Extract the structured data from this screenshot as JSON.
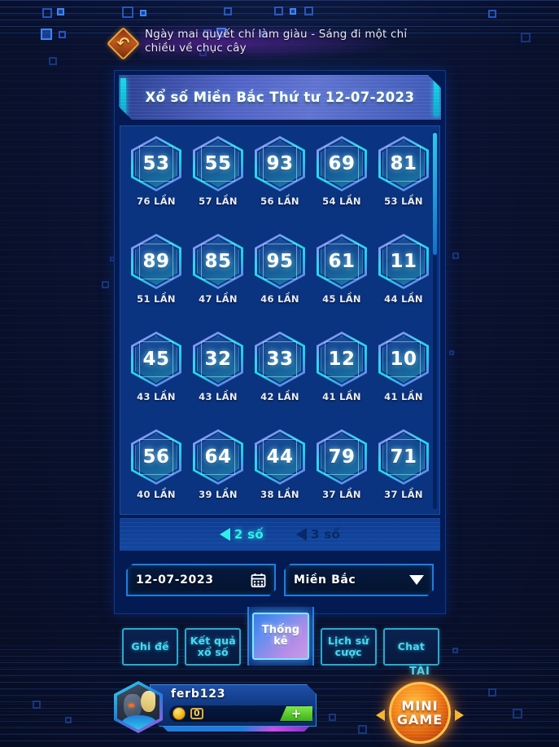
{
  "topbar": {
    "back_icon": "back-arrow-icon",
    "marquee": "Ngày mai quyết chí làm giàu - Sáng đi một chỉ chiều về chục cây"
  },
  "panel": {
    "title": "Xổ số Miền Bắc Thứ tư 12-07-2023"
  },
  "stats": {
    "rows": [
      [
        {
          "number": "53",
          "count": "76 LẦN"
        },
        {
          "number": "55",
          "count": "57 LẦN"
        },
        {
          "number": "93",
          "count": "56 LẦN"
        },
        {
          "number": "69",
          "count": "54 LẦN"
        },
        {
          "number": "81",
          "count": "53 LẦN"
        }
      ],
      [
        {
          "number": "89",
          "count": "51 LẦN"
        },
        {
          "number": "85",
          "count": "47 LẦN"
        },
        {
          "number": "95",
          "count": "46 LẦN"
        },
        {
          "number": "61",
          "count": "45 LẦN"
        },
        {
          "number": "11",
          "count": "44 LẦN"
        }
      ],
      [
        {
          "number": "45",
          "count": "43 LẦN"
        },
        {
          "number": "32",
          "count": "43 LẦN"
        },
        {
          "number": "33",
          "count": "42 LẦN"
        },
        {
          "number": "12",
          "count": "41 LẦN"
        },
        {
          "number": "10",
          "count": "41 LẦN"
        }
      ],
      [
        {
          "number": "56",
          "count": "40 LẦN"
        },
        {
          "number": "64",
          "count": "39 LẦN"
        },
        {
          "number": "44",
          "count": "38 LẦN"
        },
        {
          "number": "79",
          "count": "37 LẦN"
        },
        {
          "number": "71",
          "count": "37 LẦN"
        }
      ]
    ]
  },
  "toggles": [
    {
      "label": "2 số",
      "active": true
    },
    {
      "label": "3 số",
      "active": false
    }
  ],
  "filters": {
    "date_value": "12-07-2023",
    "date_icon": "calendar-icon",
    "region_value": "Miền Bắc",
    "region_icon": "chevron-down-icon"
  },
  "tabs": [
    {
      "label": "Ghi đề",
      "active": false
    },
    {
      "label": "Kết quả xổ số",
      "active": false
    },
    {
      "label": "Thống kê",
      "active": true
    },
    {
      "label": "Lịch sử cược",
      "active": false
    },
    {
      "label": "Chat",
      "active": false
    }
  ],
  "player": {
    "name": "ferb123",
    "coin_icon": "coin-icon",
    "coin_value": "0",
    "add_label": "+",
    "avatar_icon": "avatar-icon"
  },
  "minigame": {
    "top_label": "TÀI",
    "line1": "MINI",
    "line2": "GAME"
  },
  "colors": {
    "accent_cyan": "#2fd8f0",
    "accent_purple": "#b855e8",
    "panel_blue": "#0a3380",
    "bg_navy": "#080f26",
    "gold": "#f5b720",
    "green": "#3fb01a"
  }
}
